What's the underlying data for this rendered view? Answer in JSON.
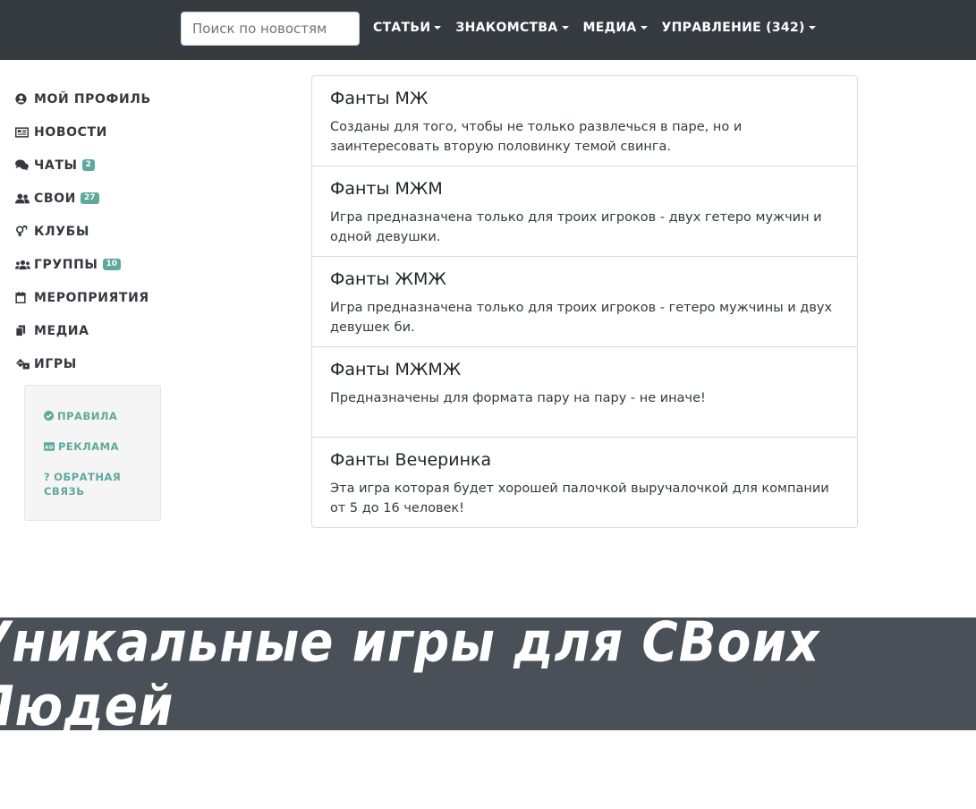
{
  "search": {
    "placeholder": "Поиск по новостям"
  },
  "nav": [
    {
      "label": "СТАТЬИ"
    },
    {
      "label": "ЗНАКОМСТВА"
    },
    {
      "label": "МЕДИА"
    },
    {
      "label": "УПРАВЛЕНИЕ (342)"
    }
  ],
  "sidebar": {
    "items": [
      {
        "label": "МОЙ ПРОФИЛЬ",
        "icon": "user-circle-icon"
      },
      {
        "label": "НОВОСТИ",
        "icon": "newspaper-icon"
      },
      {
        "label": "ЧАТЫ",
        "icon": "comments-icon",
        "badge": "2"
      },
      {
        "label": "СВОИ",
        "icon": "users-icon",
        "badge": "27"
      },
      {
        "label": "КЛУБЫ",
        "icon": "gender-icon"
      },
      {
        "label": "ГРУППЫ",
        "icon": "group-icon",
        "badge": "10"
      },
      {
        "label": "МЕРОПРИЯТИЯ",
        "icon": "calendar-icon"
      },
      {
        "label": "МЕДИА",
        "icon": "copy-icon"
      },
      {
        "label": "ИГРЫ",
        "icon": "dice-icon"
      }
    ]
  },
  "subpanel": {
    "items": [
      {
        "label": "ПРАВИЛА",
        "icon": "check-circle-icon"
      },
      {
        "label": "РЕКЛАМА",
        "icon": "ad-icon"
      },
      {
        "label": "ОБРАТНАЯ СВЯЗЬ",
        "icon": "question-icon"
      }
    ]
  },
  "games": [
    {
      "title": "Фанты МЖ",
      "description": "Созданы для того, чтобы не только развлечься в паре, но и заинтересовать вторую половинку темой свинга."
    },
    {
      "title": "Фанты МЖМ",
      "description": "Игра предназначена только для троих игроков - двух гетеро мужчин и одной девушки."
    },
    {
      "title": "Фанты ЖМЖ",
      "description": "Игра предназначена только для троих игроков - гетеро мужчины и двух девушек би."
    },
    {
      "title": "Фанты МЖМЖ",
      "description": "Предназначены для формата пару на пару - не иначе!"
    },
    {
      "title": "Фанты Вечеринка",
      "description": "Эта игра которая будет хорошей палочкой выручалочкой для компании от 5 до 16 человек!"
    }
  ],
  "banner": {
    "text": "Уникальные игры для СВоих Людей"
  },
  "colors": {
    "topbar": "#343a40",
    "accent": "#5fa89c",
    "banner": "#495057"
  }
}
